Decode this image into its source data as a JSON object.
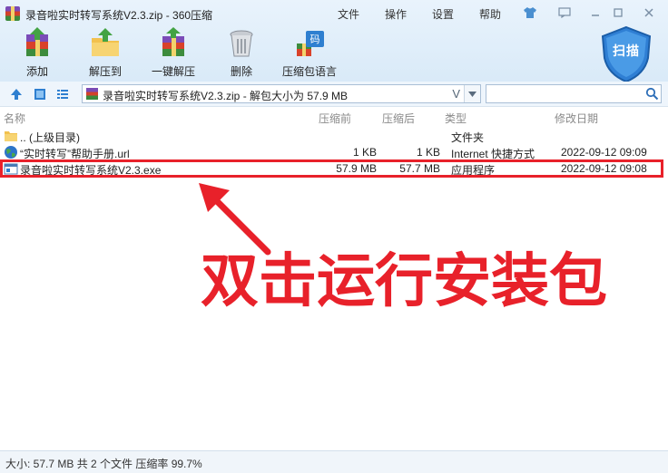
{
  "window": {
    "title": "录音啦实时转写系统V2.3.zip - 360压缩",
    "menus": [
      "文件",
      "操作",
      "设置",
      "帮助"
    ]
  },
  "toolbar": {
    "buttons": [
      {
        "label": "添加",
        "icon": "add-archive-icon"
      },
      {
        "label": "解压到",
        "icon": "extract-to-icon"
      },
      {
        "label": "一键解压",
        "icon": "one-click-extract-icon"
      },
      {
        "label": "删除",
        "icon": "delete-trash-icon"
      },
      {
        "label": "压缩包语言",
        "icon": "archive-language-icon"
      }
    ],
    "language_badge": "码",
    "scan_label": "扫描"
  },
  "address": {
    "path": "录音啦实时转写系统V2.3.zip - 解包大小为 57.9 MB",
    "v_label": "V",
    "search_placeholder": ""
  },
  "columns": {
    "name": "名称",
    "compressed_before": "压缩前",
    "compressed_after": "压缩后",
    "type": "类型",
    "modified": "修改日期"
  },
  "files": [
    {
      "name": ".. (上级目录)",
      "before": "",
      "after": "",
      "type": "文件夹",
      "modified": "",
      "icon": "folder-icon"
    },
    {
      "name": "“实时转写”帮助手册.url",
      "before": "1 KB",
      "after": "1 KB",
      "type": "Internet 快捷方式",
      "modified": "2022-09-12 09:09",
      "icon": "globe-icon"
    },
    {
      "name": "录音啦实时转写系统V2.3.exe",
      "before": "57.9 MB",
      "after": "57.7 MB",
      "type": "应用程序",
      "modified": "2022-09-12 09:08",
      "icon": "exe-app-icon"
    }
  ],
  "annotation": {
    "callout_text": "双击运行安装包",
    "accent_color": "#e8212a"
  },
  "status": {
    "text": "大小: 57.7 MB 共 2 个文件 压缩率 99.7%"
  }
}
